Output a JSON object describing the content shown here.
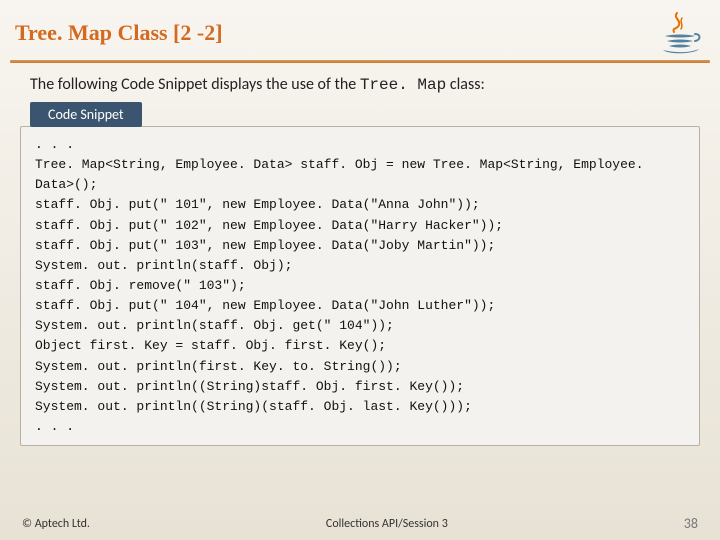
{
  "title": "Tree. Map Class [2 -2]",
  "intro_prefix": "The following Code Snippet displays the use of the ",
  "intro_class": "Tree. Map",
  "intro_suffix": " class:",
  "snippet_label": "Code Snippet",
  "code_lines": [
    ". . .",
    "Tree. Map<String, Employee. Data> staff. Obj = new Tree. Map<String, Employee. Data>();",
    "staff. Obj. put(\" 101\", new Employee. Data(\"Anna John\"));",
    "staff. Obj. put(\" 102\", new Employee. Data(\"Harry Hacker\"));",
    "staff. Obj. put(\" 103\", new Employee. Data(\"Joby Martin\"));",
    "System. out. println(staff. Obj);",
    "staff. Obj. remove(\" 103\");",
    "staff. Obj. put(\" 104\", new Employee. Data(\"John Luther\"));",
    "System. out. println(staff. Obj. get(\" 104\"));",
    "Object first. Key = staff. Obj. first. Key();",
    "System. out. println(first. Key. to. String());",
    "System. out. println((String)staff. Obj. first. Key());",
    "System. out. println((String)(staff. Obj. last. Key()));",
    ". . ."
  ],
  "footer": {
    "left": "© Aptech Ltd.",
    "center": "Collections API/Session 3",
    "right": "38"
  }
}
